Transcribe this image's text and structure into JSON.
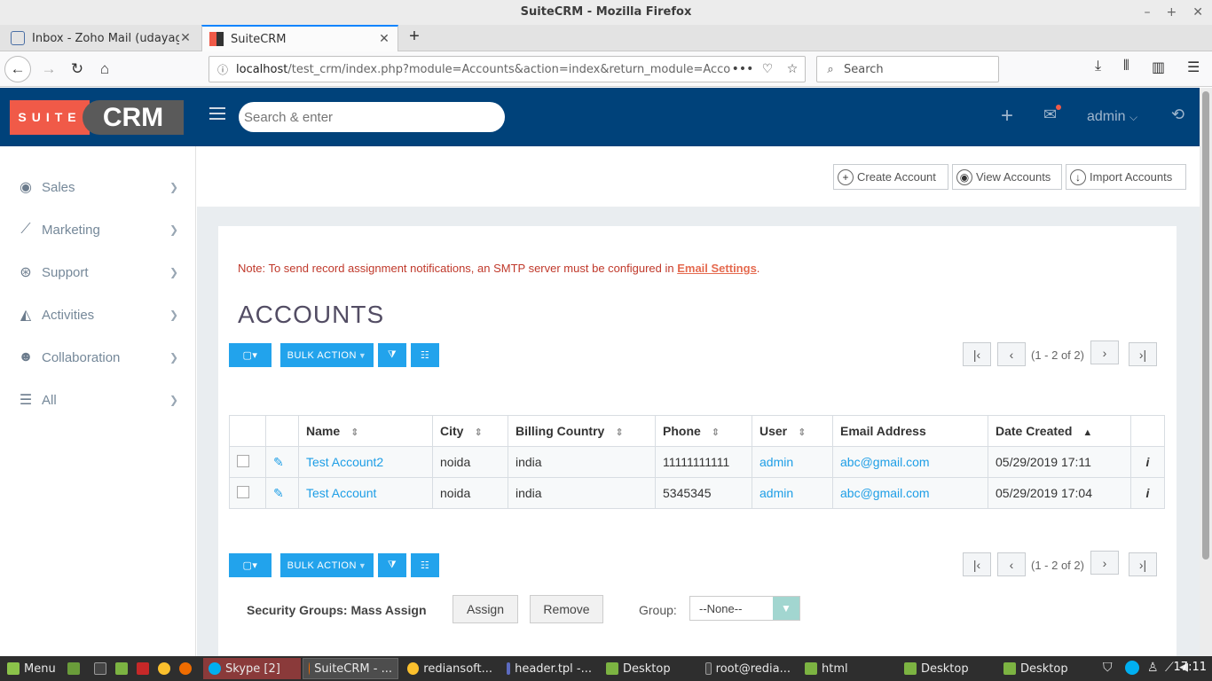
{
  "window": {
    "title": "SuiteCRM - Mozilla Firefox"
  },
  "browser": {
    "tabs": [
      {
        "title": "Inbox - Zoho Mail (udayagiri.r"
      },
      {
        "title": "SuiteCRM"
      }
    ],
    "url_host": "localhost",
    "url_path": "/test_crm/index.php?module=Accounts&action=index&return_module=Accounts&ret",
    "search_placeholder": "Search"
  },
  "crm": {
    "logo_suite": "SUITE",
    "logo_crm": "CRM",
    "search_placeholder": "Search & enter",
    "user": "admin"
  },
  "sidebar": {
    "items": [
      {
        "label": "Sales",
        "icon": "target-icon"
      },
      {
        "label": "Marketing",
        "icon": "chart-line-icon"
      },
      {
        "label": "Support",
        "icon": "lifebuoy-icon"
      },
      {
        "label": "Activities",
        "icon": "area-chart-icon"
      },
      {
        "label": "Collaboration",
        "icon": "people-icon"
      },
      {
        "label": "All",
        "icon": "list-icon"
      }
    ]
  },
  "actions": {
    "create": "Create Account",
    "view": "View Accounts",
    "import": "Import Accounts"
  },
  "notice": {
    "text": "Note: To send record assignment notifications, an SMTP server must be configured in ",
    "link": "Email Settings",
    "tail": "."
  },
  "page_title": "ACCOUNTS",
  "toolbar": {
    "bulk_action": "BULK ACTION",
    "pagination": "(1 - 2 of 2)"
  },
  "table": {
    "columns": [
      "Name",
      "City",
      "Billing Country",
      "Phone",
      "User",
      "Email Address",
      "Date Created"
    ],
    "rows": [
      {
        "name": "Test Account2",
        "city": "noida",
        "country": "india",
        "phone": "11111111111",
        "user": "admin",
        "email": "abc@gmail.com",
        "created": "05/29/2019 17:11"
      },
      {
        "name": "Test Account",
        "city": "noida",
        "country": "india",
        "phone": "5345345",
        "user": "admin",
        "email": "abc@gmail.com",
        "created": "05/29/2019 17:04"
      }
    ]
  },
  "security_groups": {
    "label": "Security Groups: Mass Assign",
    "assign": "Assign",
    "remove": "Remove",
    "group_label": "Group:",
    "group_value": "--None--"
  },
  "taskbar": {
    "menu": "Menu",
    "items": [
      {
        "label": "Skype [2]"
      },
      {
        "label": "SuiteCRM - ..."
      },
      {
        "label": "rediansoft..."
      },
      {
        "label": "header.tpl -..."
      },
      {
        "label": "Desktop"
      },
      {
        "label": "root@redia..."
      },
      {
        "label": "html"
      },
      {
        "label": "Desktop"
      },
      {
        "label": "Desktop"
      }
    ],
    "clock": "17:11"
  },
  "colors": {
    "crm_header": "#00427a",
    "accent_blue": "#22a3ec",
    "logo_red": "#f05a48",
    "notice_red": "#c0392b"
  }
}
